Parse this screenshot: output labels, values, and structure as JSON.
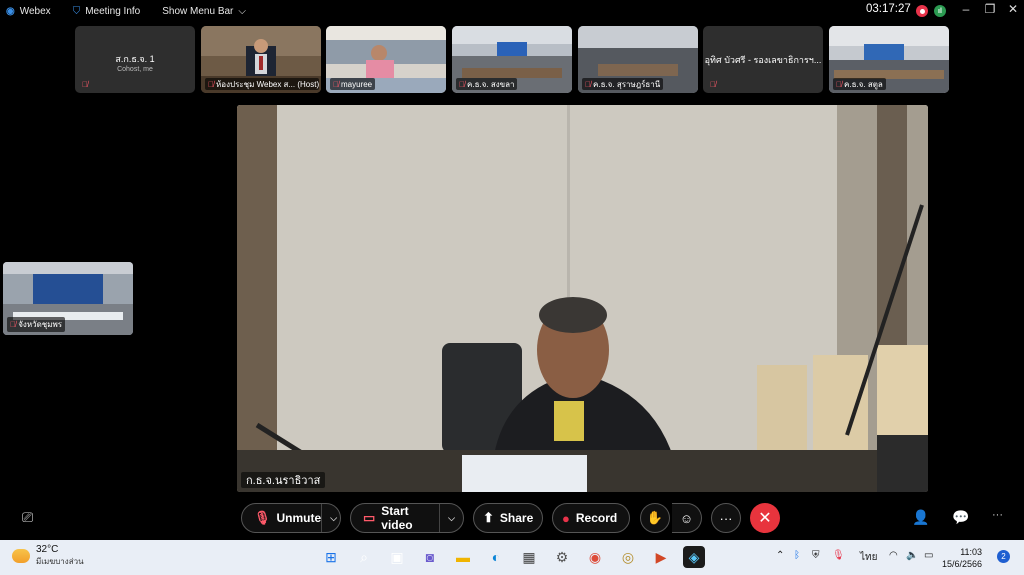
{
  "topbar": {
    "app_name": "Webex",
    "meeting_info": "Meeting Info",
    "show_menu_bar": "Show Menu Bar",
    "timer": "03:17:27"
  },
  "thumbnails": [
    {
      "name": "ส.ก.ธ.จ. 1",
      "subtitle": "Cohost, me",
      "label": ""
    },
    {
      "label": "ห้องประชุม Webex ส... (Host)"
    },
    {
      "label": "mayuree"
    },
    {
      "label": "ค.ธ.จ. สงขลา"
    },
    {
      "label": "ค.ธ.จ. สุราษฎร์ธานี"
    },
    {
      "name": "อุทิศ บัวศรี - รองเลขาธิการฯ...",
      "label": ""
    },
    {
      "label": "ค.ธ.จ. สตูล"
    }
  ],
  "main_video": {
    "label": "ก.ธ.จ.นราธิวาส"
  },
  "self_view": {
    "label": "จังหวัดชุมพร"
  },
  "controls": {
    "unmute": "Unmute",
    "start_video": "Start video",
    "share": "Share",
    "record": "Record",
    "more": "···",
    "end": "✕"
  },
  "taskbar": {
    "temp": "32°C",
    "weather": "มีเมฆบางส่วน",
    "lang": "ไทย",
    "time": "11:03",
    "date": "15/6/2566",
    "notifications": "2"
  },
  "colors": {
    "end_call": "#e8343d",
    "record": "#e8334a",
    "accent": "#1f5fd1"
  }
}
